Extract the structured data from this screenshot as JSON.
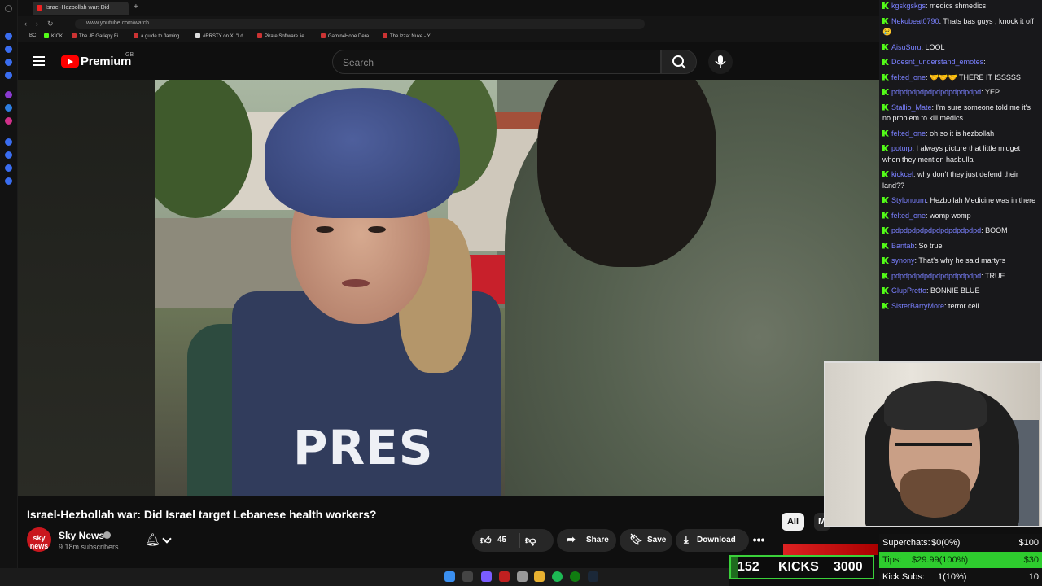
{
  "browser": {
    "tab_title": "Israel-Hezbollah war: Did",
    "new_tab": "+",
    "url": "www.youtube.com/watch",
    "bookmarks": [
      "BC",
      "KICK",
      "The JF Gariepy Fi...",
      "a guide to flaming...",
      "#RRSTY on X: \"I d...",
      "Pirate Software lie...",
      "Gamin4Hope Dera...",
      "The Izzat Nuke - Y..."
    ]
  },
  "youtube": {
    "brand": "Premium",
    "region": "GB",
    "search_placeholder": "Search"
  },
  "video": {
    "overlay_text": "PRES",
    "title": "Israel-Hezbollah war: Did Israel target Lebanese health workers?",
    "channel": "Sky News",
    "channel_avatar_text": "sky news",
    "subscribers": "9.18m subscribers",
    "likes": "45",
    "share_label": "Share",
    "save_label": "Save",
    "download_label": "Download",
    "more_label": "•••"
  },
  "chips": {
    "all": "All",
    "next": "M"
  },
  "chat": [
    {
      "user": "kgskgskgs",
      "text": "medics shmedics"
    },
    {
      "user": "Nekubeat0790",
      "text": "Thats bas guys , knock it off 😢"
    },
    {
      "user": "AisuSuru",
      "text": "LOOL"
    },
    {
      "user": "Doesnt_understand_emotes",
      "text": ""
    },
    {
      "user": "felted_one",
      "text": "🤝🤝🤝 THERE IT ISSSSS"
    },
    {
      "user": "pdpdpdpdpdpdpdpdpdpdpd",
      "text": "YEP"
    },
    {
      "user": "Stallio_Mate",
      "text": "I'm sure someone told me it's no problem to kill medics"
    },
    {
      "user": "felted_one",
      "text": "oh so it is hezbollah"
    },
    {
      "user": "poturp",
      "text": "I always picture that little midget when they mention hasbulla"
    },
    {
      "user": "kickcel",
      "text": "why don't they just defend their land??"
    },
    {
      "user": "Stylonuum",
      "text": "Hezbollah Medicine was in there"
    },
    {
      "user": "felted_one",
      "text": "womp womp"
    },
    {
      "user": "pdpdpdpdpdpdpdpdpdpdpd",
      "text": "BOOM"
    },
    {
      "user": "Bantab",
      "text": "So true"
    },
    {
      "user": "synony",
      "text": "That's why he said martyrs"
    },
    {
      "user": "pdpdpdpdpdpdpdpdpdpdpd",
      "text": "TRUE."
    },
    {
      "user": "GlupPretto",
      "text": "BONNIE BLUE"
    },
    {
      "user": "SisterBarryMore",
      "text": "terror cell"
    }
  ],
  "stream": {
    "superchats_label": "Superchats:",
    "superchats_value": "$0(0%)",
    "superchats_goal": "$100",
    "tips_label": "Tips:",
    "tips_value": "$29.99(100%)",
    "tips_goal": "$30",
    "kicksubs_label": "Kick Subs:",
    "kicksubs_value": "1(10%)",
    "kicksubs_goal": "10",
    "kicks_current": "152",
    "kicks_label": "KICKS",
    "kicks_target": "3000",
    "kicks_progress": 0.0507
  },
  "colors": {
    "kick_green": "#53fc18",
    "yt_red": "#ff0000",
    "chat_user": "#7a80ff",
    "tips_bg": "#2ecc2e"
  }
}
